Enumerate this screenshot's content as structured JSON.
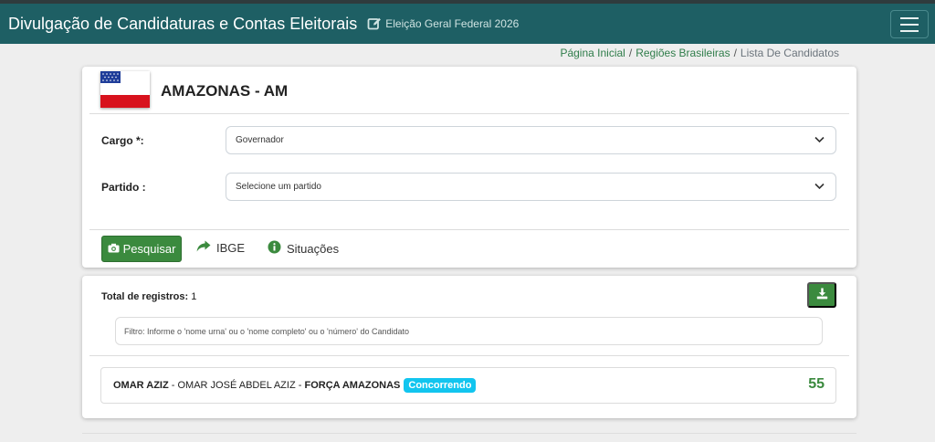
{
  "navbar": {
    "brand": "Divulgação de Candidaturas e Contas Eleitorais",
    "election": "Eleição Geral Federal 2026",
    "background_color": "#1e5f64",
    "edit_icon": "edit-icon",
    "menu_icon": "hamburger-menu-icon"
  },
  "breadcrumb": {
    "items": [
      "Página Inicial",
      "Regiões Brasileiras"
    ],
    "current": "Lista De Candidatos",
    "separator": "/"
  },
  "state": {
    "title": "AMAZONAS - AM",
    "flag": "amazonas-flag"
  },
  "form": {
    "cargo_label": "Cargo *:",
    "cargo_value": "Governador",
    "partido_label": "Partido :",
    "partido_value": "Selecione um partido"
  },
  "actions": {
    "search_label": "Pesquisar",
    "ibge_label": "IBGE",
    "situacoes_label": "Situações",
    "accent_color": "#3b8a3e"
  },
  "results": {
    "total_label": "Total de registros:",
    "total_value": "1",
    "filter_placeholder": "Filtro: Informe o 'nome urna' ou o 'nome completo' ou o 'número' do Candidato",
    "items": [
      {
        "ballot_name": "OMAR AZIZ",
        "separator": "-",
        "full_name": "OMAR JOSÉ ABDEL AZIZ",
        "party": "FORÇA AMAZONAS",
        "status": "Concorrendo",
        "number": "55",
        "status_color": "#12c5ef"
      }
    ]
  }
}
